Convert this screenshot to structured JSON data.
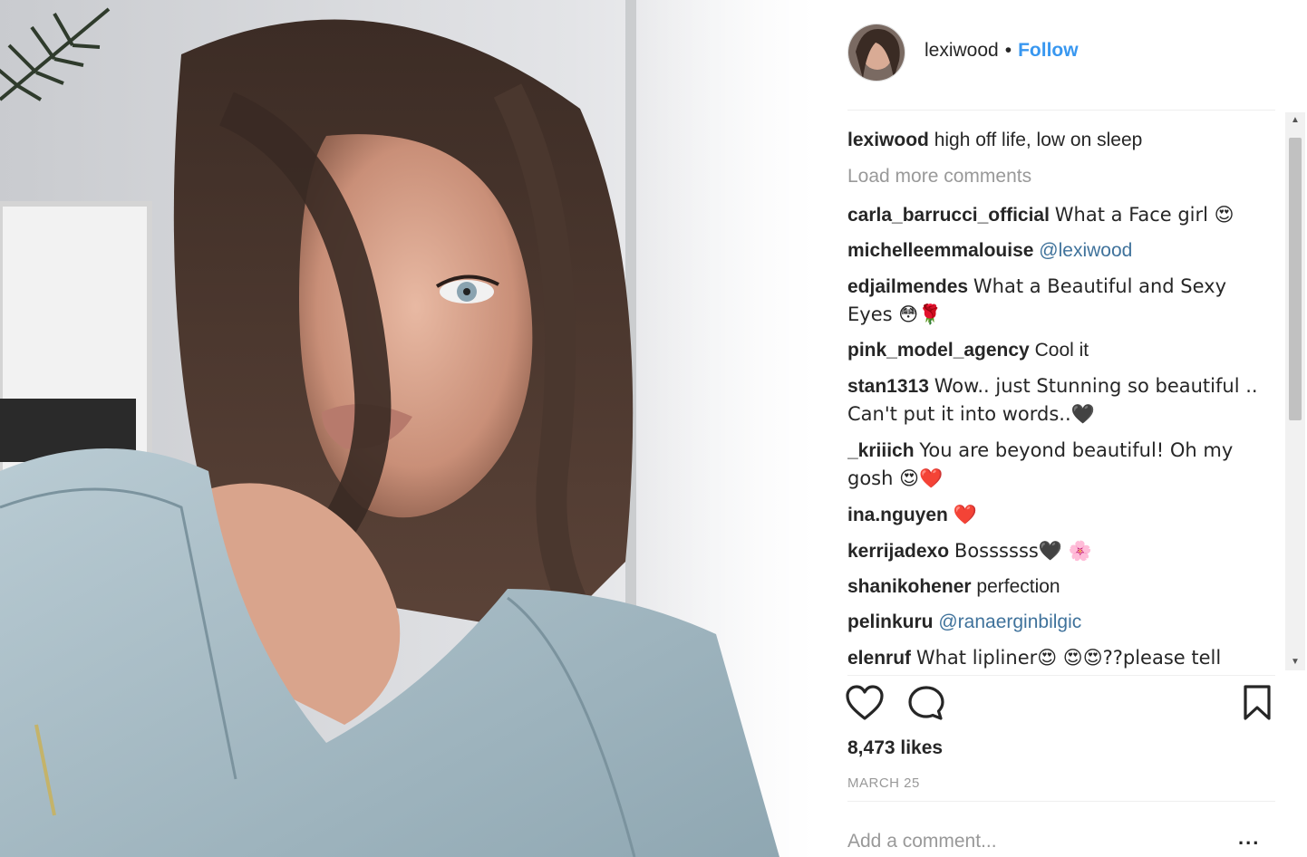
{
  "post": {
    "username": "lexiwood",
    "separator": "•",
    "follow_label": "Follow"
  },
  "caption": {
    "username": "lexiwood",
    "text": "high off life, low on sleep"
  },
  "load_more_label": "Load more comments",
  "comments": [
    {
      "user": "carla_barrucci_official",
      "text": "What a Face girl 😍"
    },
    {
      "user": "michelleemmalouise",
      "mention": "@lexiwood"
    },
    {
      "user": "edjailmendes",
      "text": "What a Beautiful and Sexy Eyes 😳🌹"
    },
    {
      "user": "pink_model_agency",
      "text": "Cool it"
    },
    {
      "user": "stan1313",
      "text": "Wow.. just Stunning so beautiful .. Can't put it into words..🖤"
    },
    {
      "user": "_kriiich",
      "text": "You are beyond beautiful! Oh my gosh 😍❤️"
    },
    {
      "user": "ina.nguyen",
      "text": "❤️"
    },
    {
      "user": "kerrijadexo",
      "text": "Bossssss🖤 🌸"
    },
    {
      "user": "shanikohener",
      "text": "perfection"
    },
    {
      "user": "pelinkuru",
      "mention": "@ranaerginbilgic"
    },
    {
      "user": "elenruf",
      "text": "What lipliner😍 😍😍??please tell"
    }
  ],
  "likes": "8,473 likes",
  "date": "MARCH 25",
  "add_comment_placeholder": "Add a comment...",
  "more_label": "...",
  "icons": [
    "heart-icon",
    "comment-icon",
    "bookmark-icon",
    "more-options-icon",
    "scroll-up-arrow",
    "scroll-down-arrow"
  ],
  "colors": {
    "follow": "#3897f0",
    "mention": "#3f729b",
    "muted": "#999999",
    "text": "#262626"
  }
}
